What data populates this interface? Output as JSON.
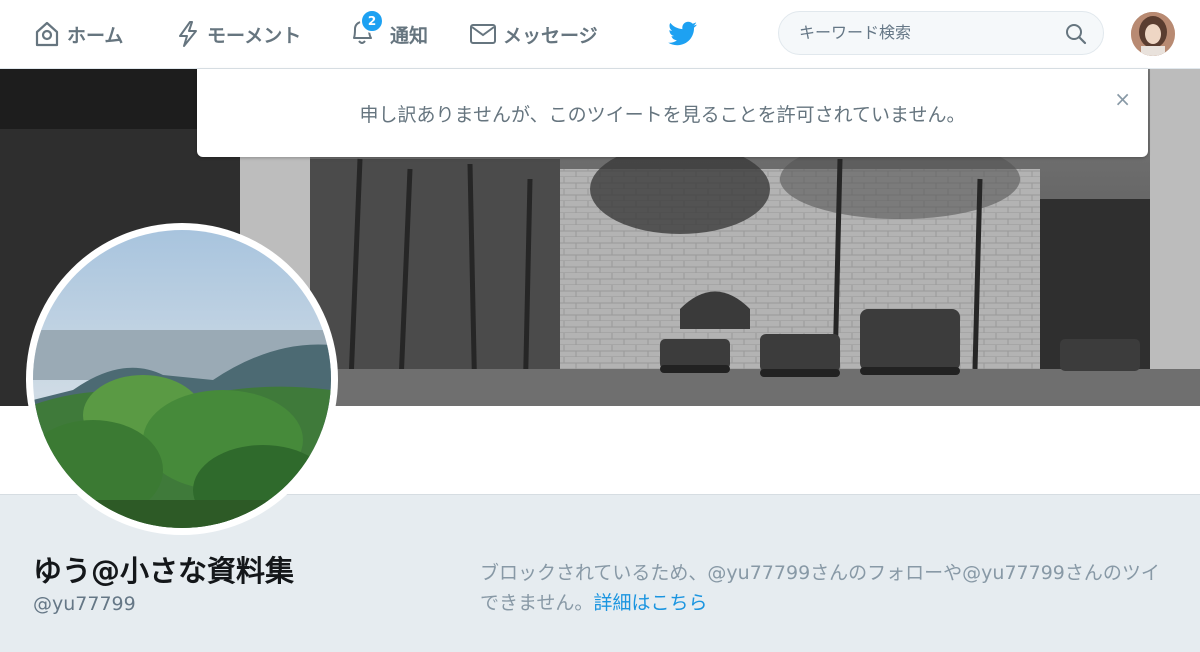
{
  "nav": {
    "home": "ホーム",
    "moments": "モーメント",
    "notifications": "通知",
    "notifications_count": "2",
    "messages": "メッセージ"
  },
  "search": {
    "placeholder": "キーワード検索"
  },
  "alert": {
    "message": "申し訳ありませんが、このツイートを見ることを許可されていません。",
    "close": "×"
  },
  "profile": {
    "name": "ゆう@小さな資料集",
    "handle": "@yu77799",
    "blocked_line1": "ブロックされているため、@yu77799さんのフォローや@yu77799さんのツイ",
    "blocked_line2": "できません。",
    "details_link": "詳細はこちら"
  },
  "colors": {
    "brand": "#1da1f2",
    "link": "#1b95e0",
    "nav_text": "#66757f",
    "background": "#e6ecf0"
  },
  "icons": [
    "home-icon",
    "lightning-icon",
    "bell-icon",
    "envelope-icon",
    "twitter-bird-icon",
    "search-icon",
    "close-icon"
  ]
}
